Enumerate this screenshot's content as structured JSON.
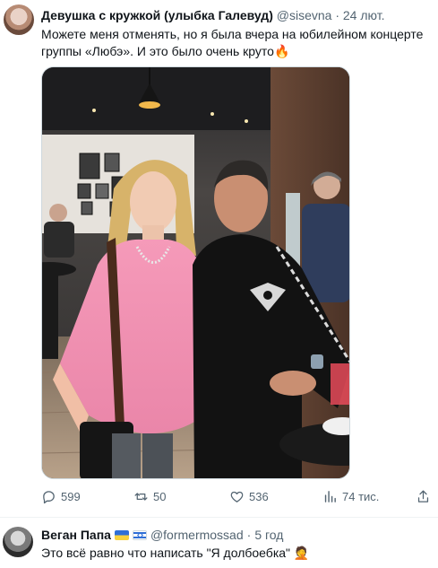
{
  "tweet": {
    "author_name": "Девушка с кружкой (улыбка Галевуд)",
    "handle": "@sisevna",
    "separator": "·",
    "time": "24 лют.",
    "text": "Можете меня отменять, но я была вчера на юбилейном концерте группы «Любэ». И это было очень круто🔥",
    "stats": {
      "replies": "599",
      "retweets": "50",
      "likes": "536",
      "views": "74 тис."
    }
  },
  "reply": {
    "author_name": "Веган Папа",
    "flags": [
      "ukraine-flag",
      "israel-flag"
    ],
    "handle": "@formermossad",
    "separator": "·",
    "time": "5 год",
    "text": "Это всё равно что написать \"Я долбоебка\" 🤦"
  },
  "icons": {
    "reply": "comment-icon",
    "retweet": "retweet-icon",
    "like": "heart-icon",
    "views": "bar-chart-icon",
    "share": "share-icon"
  },
  "colors": {
    "secondary_text": "#536471",
    "divider": "#eff3f4"
  }
}
